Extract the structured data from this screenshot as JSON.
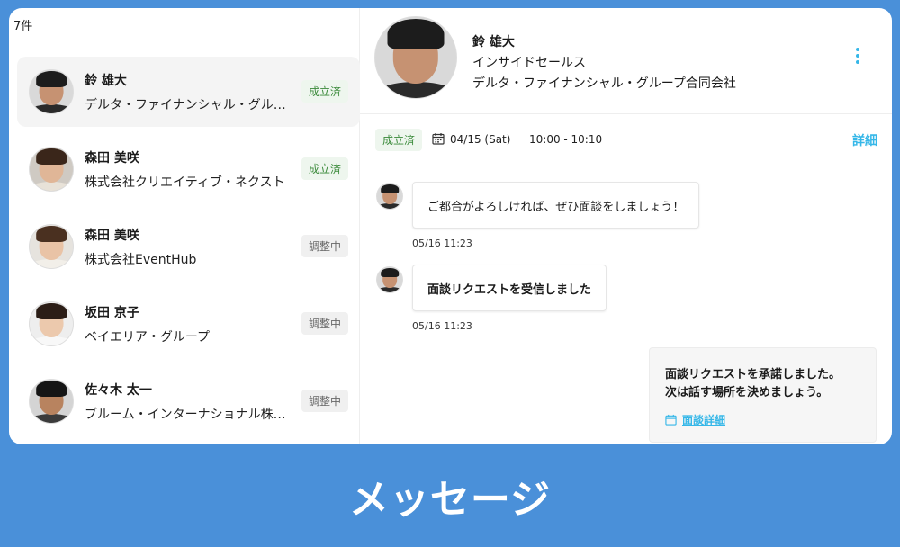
{
  "list": {
    "count": "7件",
    "items": [
      {
        "name": "鈴 雄大",
        "company": "デルタ・ファイナンシャル・グループ合同会社",
        "status": "成立済",
        "state": "done"
      },
      {
        "name": "森田 美咲",
        "company": "株式会社クリエイティブ・ネクスト",
        "status": "成立済",
        "state": "done"
      },
      {
        "name": "森田 美咲",
        "company": "株式会社EventHub",
        "status": "調整中",
        "state": "pending"
      },
      {
        "name": "坂田 京子",
        "company": "ベイエリア・グループ",
        "status": "調整中",
        "state": "pending"
      },
      {
        "name": "佐々木 太一",
        "company": "ブルーム・インターナショナル株式会社",
        "status": "調整中",
        "state": "pending"
      }
    ]
  },
  "profile": {
    "name": "鈴 雄大",
    "role": "インサイドセールス",
    "company": "デルタ・ファイナンシャル・グループ合同会社"
  },
  "meeting": {
    "status": "成立済",
    "date": "04/15 (Sat)",
    "time": "10:00 - 10:10",
    "detail_label": "詳細"
  },
  "messages": [
    {
      "text": "ご都合がよろしければ、ぜひ面談をしましょう！",
      "time": "05/16 11:23"
    },
    {
      "text": "面談リクエストを受信しました",
      "time": "05/16 11:23"
    }
  ],
  "system_card": {
    "line1": "面談リクエストを承諾しました。",
    "line2": "次は話す場所を決めましょう。",
    "link_label": "面談詳細"
  },
  "caption": "メッセージ",
  "colors": {
    "brand_blue": "#4a90d9",
    "accent_cyan": "#35b7e8",
    "done_green": "#3a8a3a"
  }
}
